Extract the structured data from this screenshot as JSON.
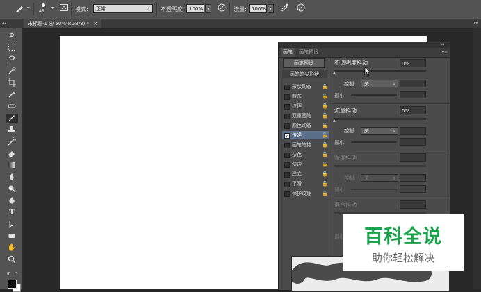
{
  "options_bar": {
    "brush_size": "45",
    "mode_label": "模式:",
    "mode_value": "正常",
    "opacity_label": "不透明度:",
    "opacity_value": "100%",
    "flow_label": "流量:",
    "flow_value": "100%"
  },
  "document_tab": {
    "title": "未标题-1 @ 50%(RGB/8) *",
    "close": "×"
  },
  "brush_panel": {
    "collapse": "◂◂",
    "tabs": [
      "画笔",
      "画笔预设"
    ],
    "menu": "▾≡",
    "preset_button": "画笔预设",
    "list_header": "画笔笔尖形状",
    "items": [
      {
        "label": "形状动态",
        "checked": false
      },
      {
        "label": "散布",
        "checked": false
      },
      {
        "label": "纹理",
        "checked": false
      },
      {
        "label": "双重画笔",
        "checked": false
      },
      {
        "label": "颜色动态",
        "checked": false
      },
      {
        "label": "传递",
        "checked": true
      },
      {
        "label": "画笔笔势",
        "checked": false
      },
      {
        "label": "杂色",
        "checked": false
      },
      {
        "label": "湿边",
        "checked": false
      },
      {
        "label": "建立",
        "checked": false
      },
      {
        "label": "平滑",
        "checked": false
      },
      {
        "label": "保护纹理",
        "checked": false
      }
    ],
    "opacity_jitter": {
      "title": "不透明度抖动",
      "value": "0%",
      "control_label": "控制:",
      "control_value": "关",
      "min_label": "最小"
    },
    "flow_jitter": {
      "title": "流量抖动",
      "value": "0%",
      "control_label": "控制:",
      "control_value": "关",
      "min_label": "最小"
    },
    "wetness_jitter": {
      "title": "湿度抖动",
      "control_label": "控制:",
      "control_value": "关",
      "min_label": "最小"
    },
    "mix_jitter": {
      "title": "混合抖动",
      "min_label": "最小"
    }
  },
  "watermark": {
    "title": "百科全说",
    "subtitle": "助你轻松解决",
    "color": "#1aa34a"
  },
  "tools": [
    "move-tool-icon",
    "marquee-tool-icon",
    "lasso-tool-icon",
    "quick-select-tool-icon",
    "crop-tool-icon",
    "eyedropper-tool-icon",
    "healing-brush-tool-icon",
    "brush-tool-icon",
    "clone-stamp-tool-icon",
    "history-brush-tool-icon",
    "eraser-tool-icon",
    "gradient-tool-icon",
    "blur-tool-icon",
    "dodge-tool-icon",
    "pen-tool-icon",
    "type-tool-icon",
    "path-select-tool-icon",
    "shape-tool-icon",
    "hand-tool-icon",
    "zoom-tool-icon"
  ]
}
